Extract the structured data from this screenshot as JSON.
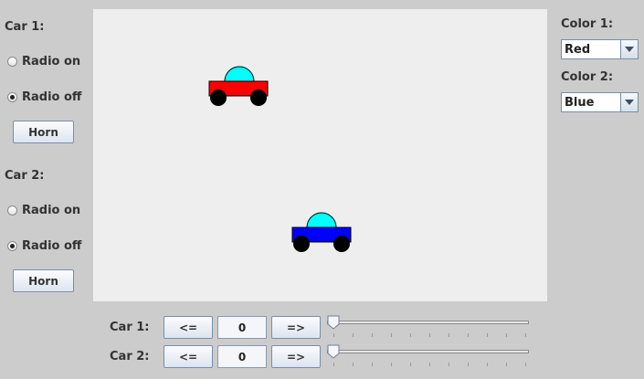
{
  "left_panel": {
    "car1_label": "Car 1:",
    "car1_radio_on": "Radio on",
    "car1_radio_off": "Radio off",
    "car1_selected": "off",
    "car1_horn": "Horn",
    "car2_label": "Car 2:",
    "car2_radio_on": "Radio on",
    "car2_radio_off": "Radio off",
    "car2_selected": "off",
    "car2_horn": "Horn"
  },
  "right_panel": {
    "color1_label": "Color 1:",
    "color1_value": "Red",
    "color2_label": "Color 2:",
    "color2_value": "Blue"
  },
  "cars": {
    "car1_body_color": "#ff0000",
    "car2_body_color": "#0000ff",
    "dome_color": "#00ffff",
    "wheel_color": "#000000"
  },
  "bottom_controls": {
    "car1_label": "Car 1:",
    "car1_left": "<=",
    "car1_value": "0",
    "car1_right": "=>",
    "car2_label": "Car 2:",
    "car2_left": "<=",
    "car2_value": "0",
    "car2_right": "=>",
    "car1_slider_value": 0,
    "car2_slider_value": 0
  }
}
